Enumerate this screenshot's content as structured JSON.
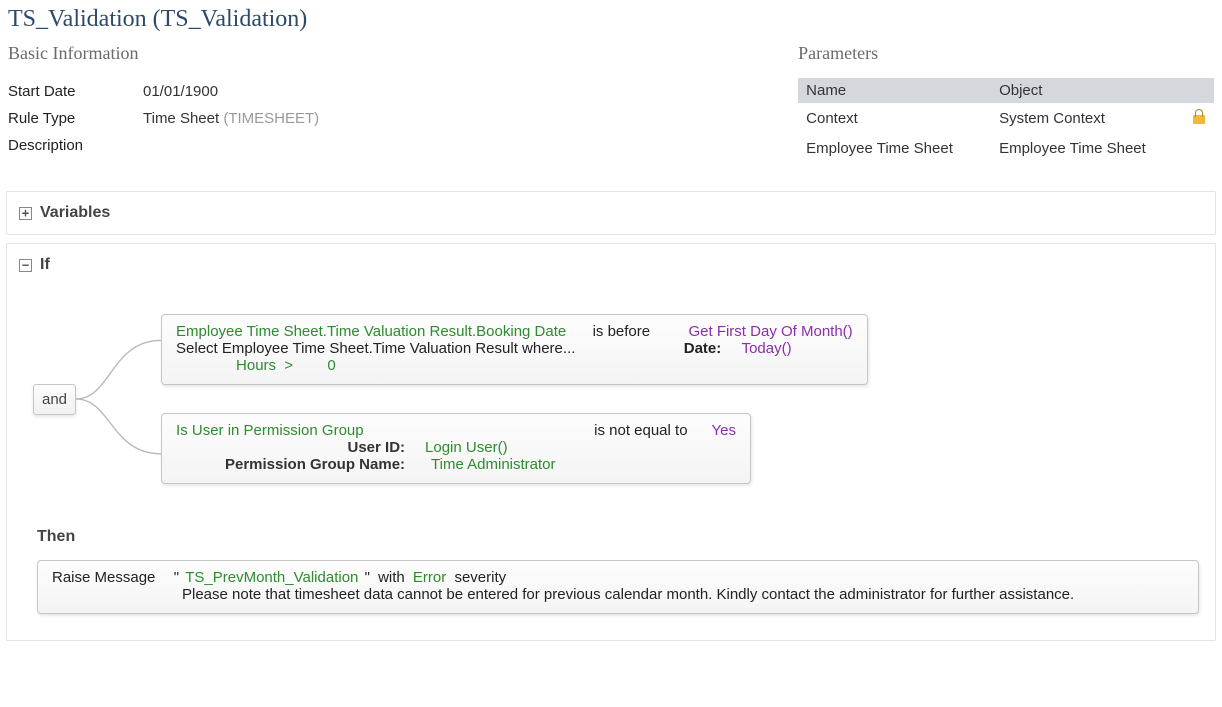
{
  "page_title": "TS_Validation (TS_Validation)",
  "basic_info": {
    "heading": "Basic Information",
    "start_date_label": "Start Date",
    "start_date_value": "01/01/1900",
    "rule_type_label": "Rule Type",
    "rule_type_value": "Time Sheet",
    "rule_type_code": "(TIMESHEET)",
    "description_label": "Description"
  },
  "parameters": {
    "heading": "Parameters",
    "col_name": "Name",
    "col_object": "Object",
    "rows": [
      {
        "name": "Context",
        "object": "System Context",
        "locked": true
      },
      {
        "name": "Employee Time Sheet",
        "object": "Employee Time Sheet",
        "locked": false
      }
    ]
  },
  "variables": {
    "heading": "Variables"
  },
  "if_block": {
    "heading": "If",
    "join": "and",
    "cond1": {
      "field": "Employee Time Sheet.Time Valuation Result.Booking Date",
      "operator": "is before",
      "func": "Get First Day Of Month()",
      "select_text": "Select Employee Time Sheet.Time Valuation Result where...",
      "date_label": "Date:",
      "date_value": "Today()",
      "filter_field": "Hours",
      "filter_op": ">",
      "filter_value": "0"
    },
    "cond2": {
      "func_name": "Is User in Permission Group",
      "operator": "is not equal to",
      "value": "Yes",
      "user_id_label": "User ID:",
      "user_id_value": "Login User()",
      "pgroup_label": "Permission Group Name:",
      "pgroup_value": "Time Administrator"
    }
  },
  "then_block": {
    "heading": "Then",
    "prefix": "Raise Message",
    "quote_open": "\"",
    "msg_name": "TS_PrevMonth_Validation",
    "quote_close": "\"",
    "with_word": "with",
    "severity": "Error",
    "severity_word": "severity",
    "detail": "Please note that timesheet data cannot be entered for previous calendar month. Kindly contact the administrator for further assistance."
  }
}
